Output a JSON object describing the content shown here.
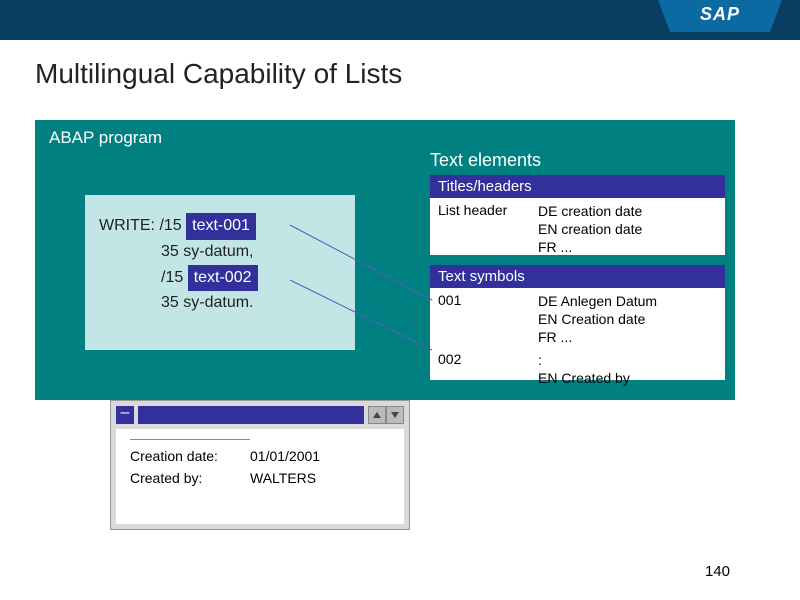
{
  "brand": "SAP",
  "title": "Multilingual Capability of Lists",
  "panel_label": "ABAP program",
  "code": {
    "l1_pre": "WRITE: /15 ",
    "hl1": "text-001",
    "l2": "35 sy-datum,",
    "l3_pre": "/15 ",
    "hl2": "text-002",
    "l4": "35 sy-datum."
  },
  "text_elements_label": "Text elements",
  "titles_headers": {
    "header": "Titles/headers",
    "col1": "List header",
    "col2_l1": "DE creation date",
    "col2_l2": "EN creation date",
    "col2_l3": "FR ..."
  },
  "text_symbols": {
    "header": "Text symbols",
    "r1_col1": "001",
    "r1_l1": "DE Anlegen Datum",
    "r1_l2": "EN Creation date",
    "r1_l3": "FR ...",
    "r2_col1": "002",
    "r2_l1": ":",
    "r2_l2": "EN Created by"
  },
  "output": {
    "row1_label": "Creation date:",
    "row1_value": "01/01/2001",
    "row2_label": "Created by:",
    "row2_value": "WALTERS"
  },
  "page_number": "140"
}
